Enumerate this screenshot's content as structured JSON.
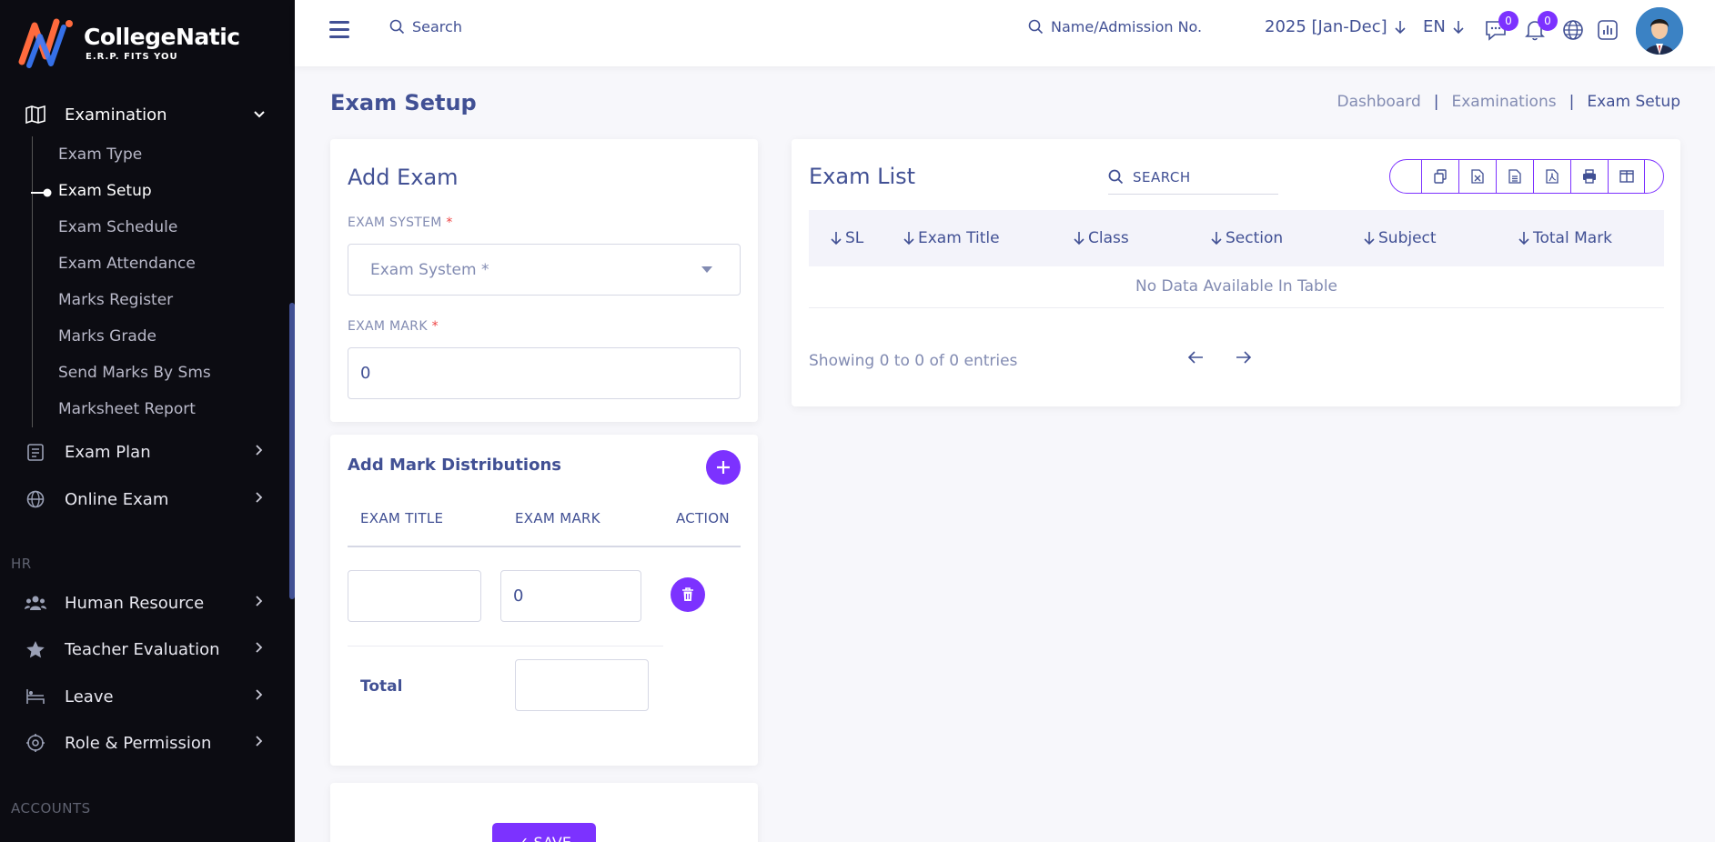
{
  "brand": {
    "name": "CollegeNatic",
    "tagline": "E.R.P. FITS YOU"
  },
  "sidebar": {
    "examination": {
      "label": "Examination"
    },
    "sub_items": [
      {
        "label": "Exam Type"
      },
      {
        "label": "Exam Setup"
      },
      {
        "label": "Exam Schedule"
      },
      {
        "label": "Exam Attendance"
      },
      {
        "label": "Marks Register"
      },
      {
        "label": "Marks Grade"
      },
      {
        "label": "Send Marks By Sms"
      },
      {
        "label": "Marksheet Report"
      }
    ],
    "groups": [
      {
        "label": "Exam Plan"
      },
      {
        "label": "Online Exam"
      }
    ],
    "hr_title": "HR",
    "hr_groups": [
      {
        "label": "Human Resource"
      },
      {
        "label": "Teacher Evaluation"
      },
      {
        "label": "Leave"
      },
      {
        "label": "Role & Permission"
      }
    ],
    "accounts_title": "ACCOUNTS"
  },
  "topbar": {
    "search_label": "Search",
    "name_search_label": "Name/Admission No.",
    "year": "2025 [Jan-Dec]",
    "language": "EN",
    "messages_count": "0",
    "notifications_count": "0"
  },
  "page": {
    "title": "Exam Setup",
    "breadcrumb": [
      "Dashboard",
      "Examinations",
      "Exam Setup"
    ]
  },
  "add_exam": {
    "title": "Add Exam",
    "exam_system_label": "EXAM SYSTEM",
    "exam_system_placeholder": "Exam System *",
    "exam_mark_label": "EXAM MARK",
    "exam_mark_value": "0"
  },
  "distributions": {
    "title": "Add Mark Distributions",
    "col_title": "EXAM TITLE",
    "col_mark": "EXAM MARK",
    "col_action": "ACTION",
    "row_title_value": "",
    "row_mark_value": "0",
    "total_label": "Total",
    "total_value": ""
  },
  "save": {
    "label": "✓ SAVE"
  },
  "exam_list": {
    "title": "Exam List",
    "search_label": "SEARCH",
    "columns": [
      "SL",
      "Exam Title",
      "Class",
      "Section",
      "Subject",
      "Total Mark"
    ],
    "empty_text": "No Data Available In Table",
    "showing_text": "Showing 0 to 0 of 0 entries"
  },
  "colors": {
    "accent": "#7c32ff",
    "text": "#415094",
    "sidebar": "#0c0c12"
  }
}
